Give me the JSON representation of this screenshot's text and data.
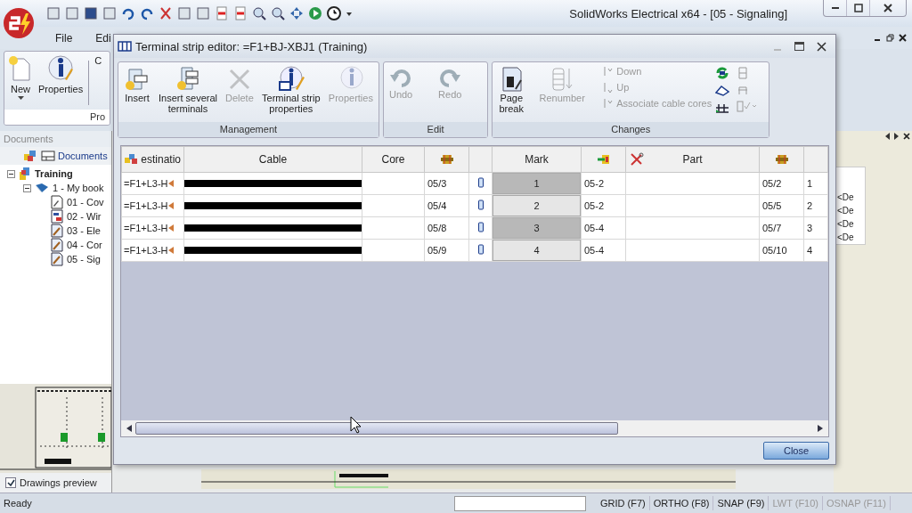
{
  "app": {
    "title": "SolidWorks Electrical x64 - [05 - Signaling]",
    "menu": [
      {
        "label": "File"
      },
      {
        "label": "Edi"
      }
    ],
    "ribbon": {
      "buttons": [
        {
          "label": "New",
          "dropdown": true
        },
        {
          "label": "Properties",
          "dropdown": false
        },
        {
          "label": "C",
          "dropdown": false
        }
      ],
      "group": "Pro"
    },
    "documents_panel": {
      "title": "Documents",
      "tab": "Documents",
      "tree": [
        {
          "label": "Training",
          "kind": "project",
          "expanded": true,
          "children": [
            {
              "label": "1 - My book",
              "kind": "book",
              "expanded": true,
              "children": [
                {
                  "label": "01 - Cov",
                  "kind": "cover"
                },
                {
                  "label": "02 - Wir",
                  "kind": "list"
                },
                {
                  "label": "03 - Ele",
                  "kind": "drawing"
                },
                {
                  "label": "04 - Cor",
                  "kind": "drawing"
                },
                {
                  "label": "05 - Sig",
                  "kind": "drawing"
                }
              ]
            }
          ]
        }
      ],
      "drawings_preview": {
        "label": "Drawings preview",
        "checked": true
      }
    },
    "right_panel": {
      "items": [
        "<De",
        "<De",
        "<De",
        "<De"
      ]
    },
    "status_bar": {
      "text": "Ready",
      "toggles": [
        {
          "label": "GRID (F7)",
          "on": true
        },
        {
          "label": "ORTHO (F8)",
          "on": true
        },
        {
          "label": "SNAP (F9)",
          "on": true
        },
        {
          "label": "LWT (F10)",
          "on": false
        },
        {
          "label": "OSNAP (F11)",
          "on": false
        }
      ]
    }
  },
  "dialog": {
    "title": "Terminal strip editor: =F1+BJ-XBJ1 (Training)",
    "groups": [
      {
        "label": "Management",
        "buttons": [
          {
            "label": "Insert",
            "disabled": false
          },
          {
            "label": "Insert several terminals",
            "disabled": false
          },
          {
            "label": "Delete",
            "disabled": true
          },
          {
            "label": "Terminal strip properties",
            "disabled": false
          },
          {
            "label": "Properties",
            "disabled": true
          }
        ]
      },
      {
        "label": "Edit",
        "buttons": [
          {
            "label": "Undo",
            "disabled": true
          },
          {
            "label": "Redo",
            "disabled": true
          }
        ]
      },
      {
        "label": "Changes",
        "buttons": [
          {
            "label": "Page break",
            "disabled": false
          },
          {
            "label": "Renumber",
            "disabled": true
          }
        ],
        "small_buttons": [
          {
            "label": "Down",
            "disabled": true
          },
          {
            "label": "Up",
            "disabled": true
          },
          {
            "label": "Associate cable cores",
            "disabled": true
          }
        ]
      }
    ],
    "table": {
      "columns": [
        {
          "kind": "text",
          "label": "estinatio"
        },
        {
          "kind": "text",
          "label": "Cable"
        },
        {
          "kind": "text",
          "label": "Core"
        },
        {
          "kind": "icon"
        },
        {
          "kind": "blank"
        },
        {
          "kind": "text",
          "label": "Mark"
        },
        {
          "kind": "icon"
        },
        {
          "kind": "text",
          "label": "Part"
        },
        {
          "kind": "icon"
        },
        {
          "kind": "blank"
        }
      ],
      "rows": [
        {
          "destination": "=F1+L3-H",
          "column_4": "05/3",
          "mark": "1",
          "highlighted": true,
          "column_7": "05-2",
          "column_9": "05/2",
          "column_10": "1"
        },
        {
          "destination": "=F1+L3-H",
          "column_4": "05/4",
          "mark": "2",
          "highlighted": false,
          "column_7": "05-2",
          "column_9": "05/5",
          "column_10": "2"
        },
        {
          "destination": "=F1+L3-H",
          "column_4": "05/8",
          "mark": "3",
          "highlighted": true,
          "column_7": "05-4",
          "column_9": "05/7",
          "column_10": "3"
        },
        {
          "destination": "=F1+L3-H",
          "column_4": "05/9",
          "mark": "4",
          "highlighted": false,
          "column_7": "05-4",
          "column_9": "05/10",
          "column_10": "4"
        }
      ]
    },
    "close_button": "Close"
  }
}
